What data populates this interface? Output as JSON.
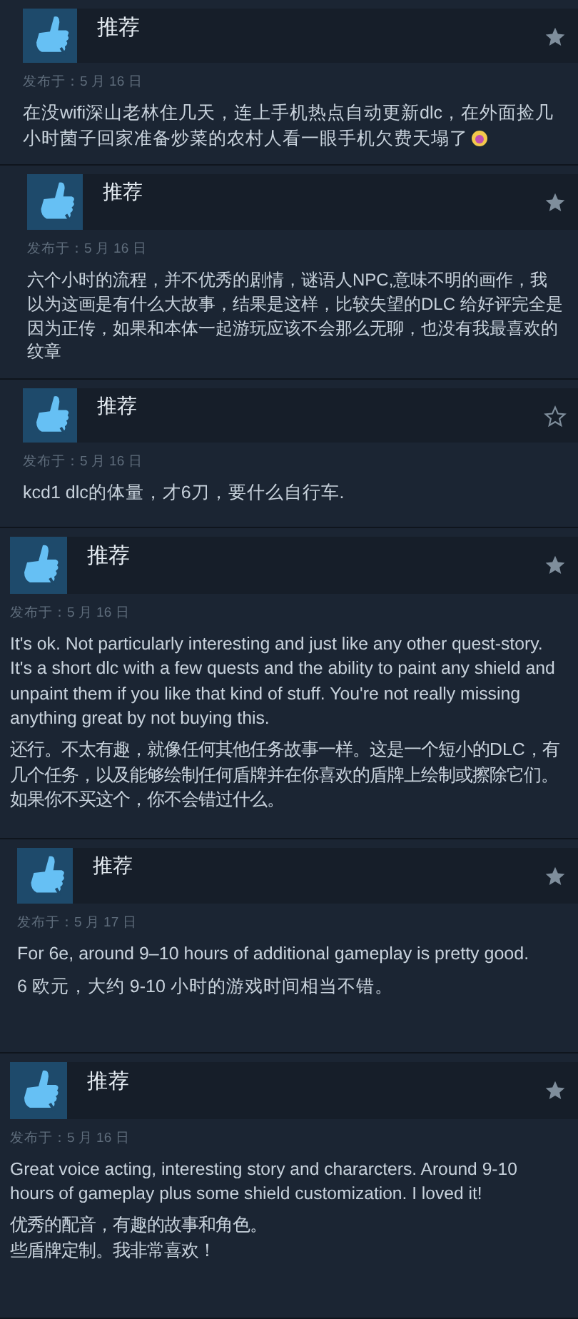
{
  "reviews": [
    {
      "verdict": "推荐",
      "starred": true,
      "date": "发布于：5 月 16 日",
      "end_emoji": true,
      "paragraphs": [
        {
          "lines": [
            "在没wifi深山老林住几天，连上手机热点自动更新dlc，在外面捡几小时菌子回家准备炒菜的农村人看一眼手机欠费天塌了"
          ]
        }
      ]
    },
    {
      "verdict": "推荐",
      "starred": true,
      "date": "发布于：5 月 16 日",
      "paragraphs": [
        {
          "lines": [
            "六个小时的流程，并不优秀的剧情，谜语人NPC,意味不明的画作，我以为这画是有什么大故事，结果是这样，比较失望的DLC 给好评完全是因为正传，如果和本体一起游玩应该不会那么无聊，也没有我最喜欢的纹章"
          ]
        }
      ]
    },
    {
      "verdict": "推荐",
      "starred": false,
      "date": "发布于：5 月 16 日",
      "paragraphs": [
        {
          "lines": [
            "kcd1 dlc的体量，才6刀，要什么自行车."
          ]
        }
      ]
    },
    {
      "verdict": "推荐",
      "starred": true,
      "date": "发布于：5 月 16 日",
      "paragraphs": [
        {
          "lines": [
            "It's ok. Not particularly interesting and just like any other quest-story. It's a short dlc with a few quests and the ability to paint any shield and unpaint them if you like that kind of stuff. You're not really missing anything great by not buying this."
          ]
        },
        {
          "lines": [
            "还行。不太有趣，就像任何其他任务故事一样。这是一个短小的DLC，有几个任务，以及能够绘制任何盾牌并在你喜欢的盾牌上绘制或擦除它们。如果你不买这个，你不会错过什么。"
          ]
        }
      ]
    },
    {
      "verdict": "推荐",
      "starred": true,
      "date": "发布于：5 月 17 日",
      "paragraphs": [
        {
          "lines": [
            "For 6e, around 9–10 hours of additional gameplay is pretty good."
          ]
        },
        {
          "lines": [
            "6 欧元，大约 9-10 小时的游戏时间相当不错。"
          ]
        }
      ]
    },
    {
      "verdict": "推荐",
      "starred": true,
      "date": "发布于：5 月 16 日",
      "paragraphs": [
        {
          "lines": [
            "Great voice acting, interesting story and chararcters. Around 9-10 hours of gameplay plus some shield customization. I loved it!"
          ]
        },
        {
          "lines": [
            "优秀的配音，有趣的故事和角色。",
            "些盾牌定制。我非常喜欢！"
          ]
        }
      ]
    }
  ]
}
